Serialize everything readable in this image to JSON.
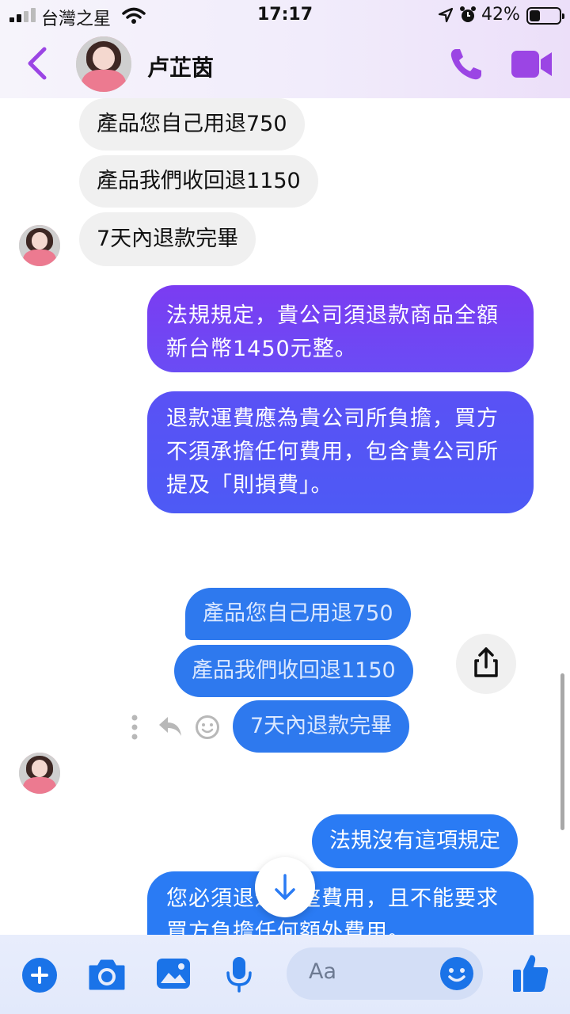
{
  "status_bar": {
    "carrier": "台灣之星",
    "time": "17:17",
    "battery": "42%",
    "battery_level": 0.42
  },
  "header": {
    "contact_name": "卢芷茵",
    "back_icon": "chevron-left-icon",
    "call_icon": "phone-icon",
    "video_icon": "video-camera-icon",
    "accent_color": "#9b45e4"
  },
  "messages": {
    "received": [
      "產品您自己用退750",
      "產品我們收回退1150",
      "7天內退款完畢"
    ],
    "sent_1": "法規規定，貴公司須退款商品全額新台幣1450元整。",
    "sent_2": "退款運費應為貴公司所負擔，買方不須承擔任何費用，包含貴公司所提及「則損費」。",
    "quoted": [
      "產品您自己用退750",
      "產品我們收回退1150",
      "7天內退款完畢"
    ],
    "sent_3": "法規沒有這項規定",
    "sent_4": "您必須退還完整費用，且不能要求買方負擔任何額外費用。"
  },
  "composer": {
    "placeholder": "Aa",
    "icons": [
      "plus-icon",
      "camera-icon",
      "image-icon",
      "microphone-icon",
      "emoji-icon",
      "thumbs-up-icon"
    ],
    "accent_color": "#1a73e8"
  }
}
